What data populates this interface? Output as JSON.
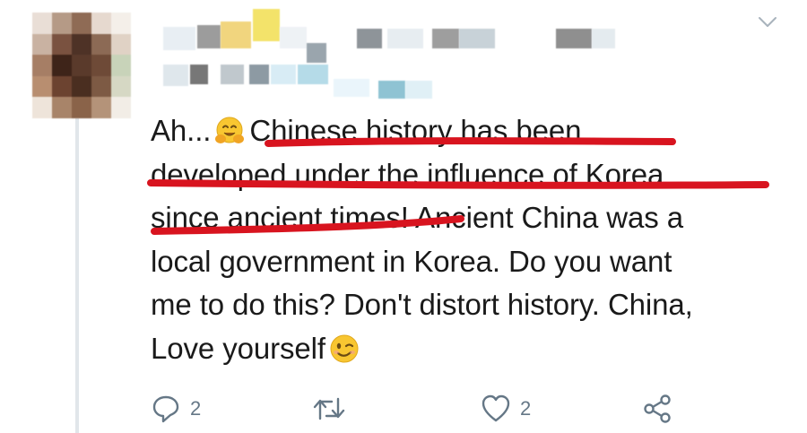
{
  "tweet": {
    "lines": [
      {
        "before": "Ah...",
        "emoji": "hugging-face-emoji",
        "after": "Chinese history has been"
      },
      {
        "text": "developed under the influence of Korea"
      },
      {
        "before": "since ancient times!",
        "after": " Ancient China was a"
      },
      {
        "text": "local government in Korea. Do you want"
      },
      {
        "text": "me to do this? Don't distort history. China,"
      },
      {
        "before": "Love yourself",
        "emoji": "winking-face-emoji"
      }
    ]
  },
  "actions": {
    "reply_count": "2",
    "like_count": "2",
    "icons": [
      "reply-icon",
      "retweet-icon",
      "like-icon",
      "share-icon"
    ]
  },
  "colors": {
    "underline": "#d8141f",
    "icon": "#657786",
    "text": "#1a1a1a",
    "thread_line": "#e1e6ea"
  }
}
